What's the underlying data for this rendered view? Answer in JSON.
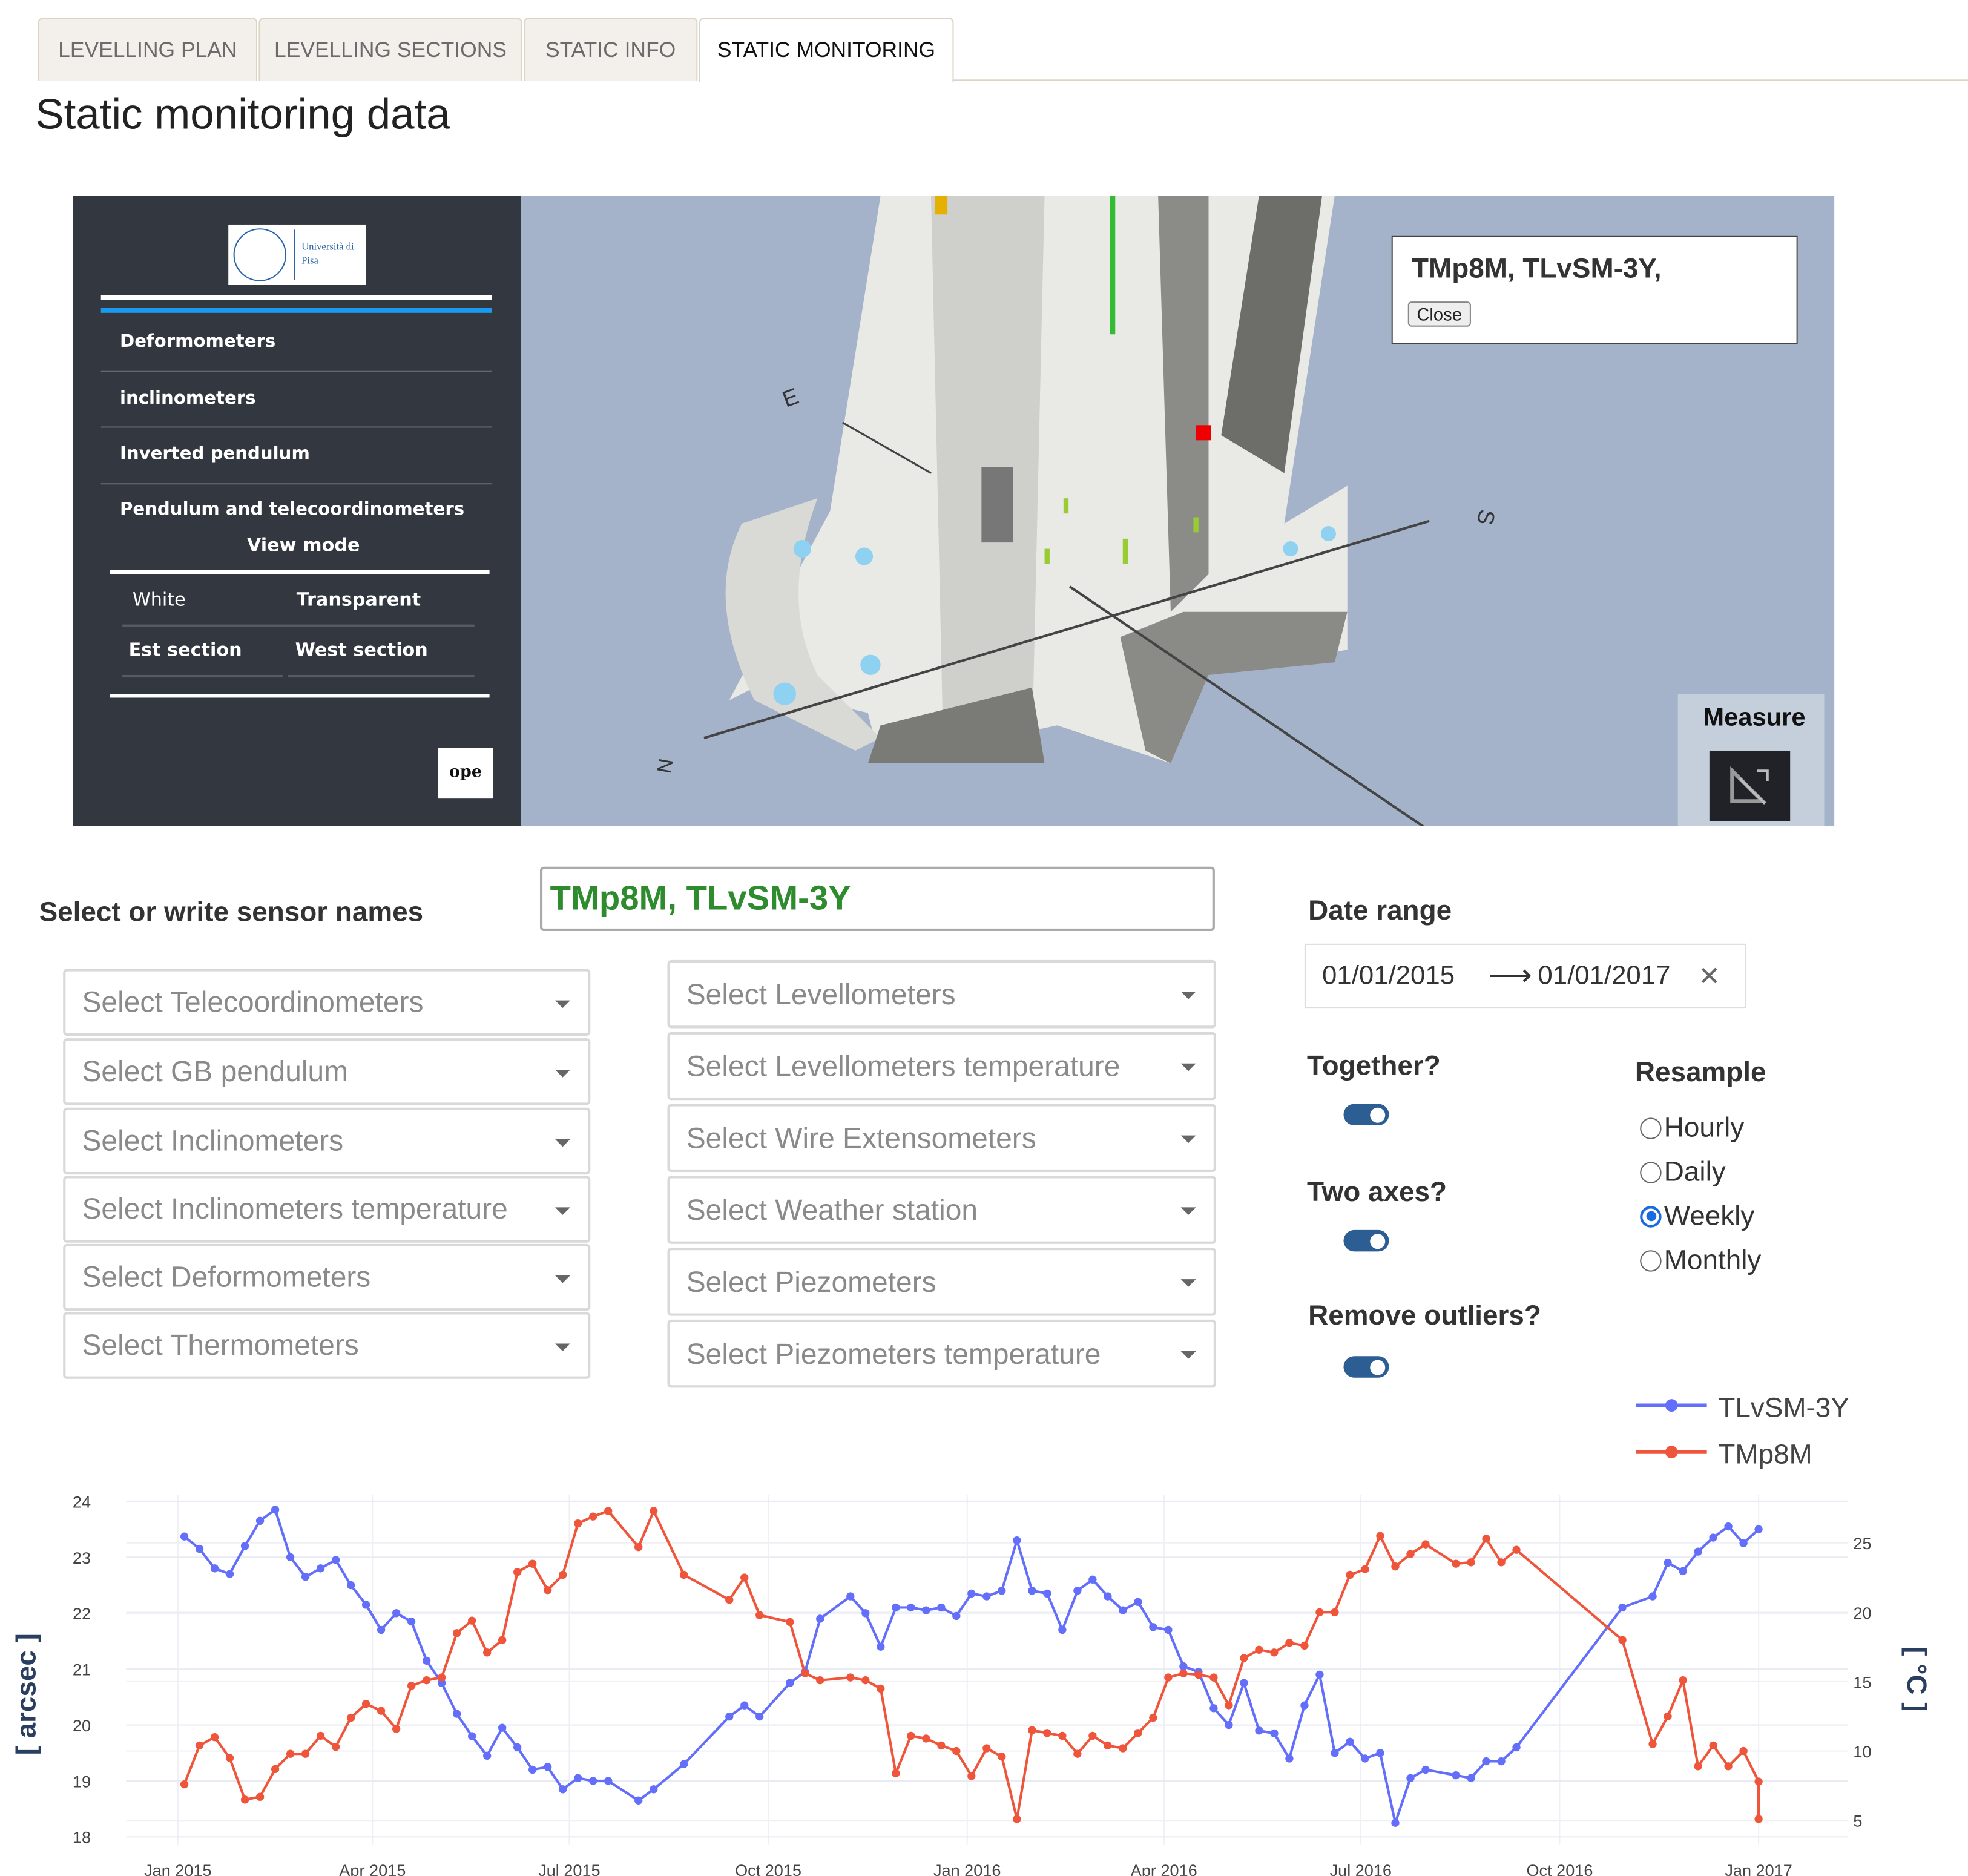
{
  "tabs": [
    {
      "label": "LEVELLING PLAN",
      "active": false
    },
    {
      "label": "LEVELLING SECTIONS",
      "active": false
    },
    {
      "label": "STATIC INFO",
      "active": false
    },
    {
      "label": "STATIC MONITORING",
      "active": true
    }
  ],
  "page_title": "Static monitoring data",
  "viewer": {
    "logo_text": "Università di Pisa",
    "menu": [
      "Deformometers",
      "inclinometers",
      "Inverted pendulum",
      "Pendulum and telecoordinometers"
    ],
    "view_mode_title": "View mode",
    "view_modes": [
      "White",
      "Transparent",
      "Est section",
      "West section"
    ],
    "ope_logo": "ope",
    "popup_text": "TMp8M, TLvSM-3Y,",
    "popup_close": "Close",
    "measure_label": "Measure",
    "compass": {
      "e": "E",
      "s": "S",
      "n": "N"
    }
  },
  "sensor_select": {
    "label": "Select or write sensor names",
    "value": "TMp8M, TLvSM-3Y",
    "left_dropdowns": [
      "Select Telecoordinometers",
      "Select GB pendulum",
      "Select Inclinometers",
      "Select Inclinometers temperature",
      "Select Deformometers",
      "Select Thermometers"
    ],
    "right_dropdowns": [
      "Select Levellometers",
      "Select Levellometers temperature",
      "Select Wire Extensometers",
      "Select Weather station",
      "Select Piezometers",
      "Select Piezometers temperature"
    ]
  },
  "date_range": {
    "label": "Date range",
    "start": "01/01/2015",
    "end": "01/01/2017"
  },
  "options": {
    "together": {
      "label": "Together?",
      "on": true
    },
    "two_axes": {
      "label": "Two axes?",
      "on": true
    },
    "remove_outliers": {
      "label": "Remove outliers?",
      "on": true
    }
  },
  "resample": {
    "label": "Resample",
    "options": [
      "Hourly",
      "Daily",
      "Weekly",
      "Monthly"
    ],
    "selected": "Weekly"
  },
  "colors": {
    "blue": "#636efa",
    "red": "#ef553b",
    "toggle": "#2d5e93"
  },
  "chart_data": {
    "type": "line",
    "title": "",
    "xlabel": "",
    "ylabel": "[ arcsec ]",
    "y2label": "[ °C ]",
    "ylim": [
      18,
      24
    ],
    "y2lim": [
      3.8,
      28
    ],
    "xlim": [
      "2014-12-20",
      "2017-01-20"
    ],
    "x_ticks": [
      {
        "date": "2015-01-01",
        "label": "Jan 2015"
      },
      {
        "date": "2015-04-01",
        "label": "Apr 2015"
      },
      {
        "date": "2015-07-01",
        "label": "Jul 2015"
      },
      {
        "date": "2015-10-01",
        "label": "Oct 2015"
      },
      {
        "date": "2016-01-01",
        "label": "Jan 2016"
      },
      {
        "date": "2016-04-01",
        "label": "Apr 2016"
      },
      {
        "date": "2016-07-01",
        "label": "Jul 2016"
      },
      {
        "date": "2016-10-01",
        "label": "Oct 2016"
      },
      {
        "date": "2017-01-01",
        "label": "Jan 2017"
      }
    ],
    "y_ticks": [
      "18",
      "19",
      "20",
      "21",
      "22",
      "23",
      "24"
    ],
    "y2_ticks": [
      "5",
      "10",
      "15",
      "20",
      "25"
    ],
    "legend_position": "top-right",
    "grid": true,
    "series": [
      {
        "name": "TLvSM-3Y",
        "axis": "y",
        "color": "#636efa",
        "points": [
          [
            "2015-01-04",
            23.37
          ],
          [
            "2015-01-11",
            23.15
          ],
          [
            "2015-01-18",
            22.8
          ],
          [
            "2015-01-25",
            22.7
          ],
          [
            "2015-02-01",
            23.2
          ],
          [
            "2015-02-08",
            23.65
          ],
          [
            "2015-02-15",
            23.85
          ],
          [
            "2015-02-22",
            23.0
          ],
          [
            "2015-03-01",
            22.65
          ],
          [
            "2015-03-08",
            22.8
          ],
          [
            "2015-03-15",
            22.95
          ],
          [
            "2015-03-22",
            22.5
          ],
          [
            "2015-03-29",
            22.15
          ],
          [
            "2015-04-05",
            21.7
          ],
          [
            "2015-04-12",
            22.0
          ],
          [
            "2015-04-19",
            21.85
          ],
          [
            "2015-04-26",
            21.15
          ],
          [
            "2015-05-03",
            20.75
          ],
          [
            "2015-05-10",
            20.2
          ],
          [
            "2015-05-17",
            19.8
          ],
          [
            "2015-05-24",
            19.45
          ],
          [
            "2015-05-31",
            19.95
          ],
          [
            "2015-06-07",
            19.6
          ],
          [
            "2015-06-14",
            19.2
          ],
          [
            "2015-06-21",
            19.25
          ],
          [
            "2015-06-28",
            18.85
          ],
          [
            "2015-07-05",
            19.05
          ],
          [
            "2015-07-12",
            19.0
          ],
          [
            "2015-07-19",
            19.0
          ],
          [
            "2015-08-02",
            18.65
          ],
          [
            "2015-08-09",
            18.85
          ],
          [
            "2015-08-23",
            19.3
          ],
          [
            "2015-09-13",
            20.15
          ],
          [
            "2015-09-20",
            20.35
          ],
          [
            "2015-09-27",
            20.15
          ],
          [
            "2015-10-11",
            20.75
          ],
          [
            "2015-10-18",
            20.95
          ],
          [
            "2015-10-25",
            21.9
          ],
          [
            "2015-11-08",
            22.3
          ],
          [
            "2015-11-15",
            22.0
          ],
          [
            "2015-11-22",
            21.4
          ],
          [
            "2015-11-29",
            22.1
          ],
          [
            "2015-12-06",
            22.1
          ],
          [
            "2015-12-13",
            22.05
          ],
          [
            "2015-12-20",
            22.1
          ],
          [
            "2015-12-27",
            21.95
          ],
          [
            "2016-01-03",
            22.35
          ],
          [
            "2016-01-10",
            22.3
          ],
          [
            "2016-01-17",
            22.4
          ],
          [
            "2016-01-24",
            23.3
          ],
          [
            "2016-01-31",
            22.4
          ],
          [
            "2016-02-07",
            22.35
          ],
          [
            "2016-02-14",
            21.7
          ],
          [
            "2016-02-21",
            22.4
          ],
          [
            "2016-02-28",
            22.6
          ],
          [
            "2016-03-06",
            22.3
          ],
          [
            "2016-03-13",
            22.05
          ],
          [
            "2016-03-20",
            22.2
          ],
          [
            "2016-03-27",
            21.75
          ],
          [
            "2016-04-03",
            21.7
          ],
          [
            "2016-04-10",
            21.05
          ],
          [
            "2016-04-17",
            20.95
          ],
          [
            "2016-04-24",
            20.3
          ],
          [
            "2016-05-01",
            20.0
          ],
          [
            "2016-05-08",
            20.75
          ],
          [
            "2016-05-15",
            19.9
          ],
          [
            "2016-05-22",
            19.85
          ],
          [
            "2016-05-29",
            19.4
          ],
          [
            "2016-06-05",
            20.35
          ],
          [
            "2016-06-12",
            20.9
          ],
          [
            "2016-06-19",
            19.5
          ],
          [
            "2016-06-26",
            19.7
          ],
          [
            "2016-07-03",
            19.4
          ],
          [
            "2016-07-10",
            19.5
          ],
          [
            "2016-07-17",
            18.25
          ],
          [
            "2016-07-24",
            19.05
          ],
          [
            "2016-07-31",
            19.2
          ],
          [
            "2016-08-14",
            19.1
          ],
          [
            "2016-08-21",
            19.05
          ],
          [
            "2016-08-28",
            19.35
          ],
          [
            "2016-09-04",
            19.35
          ],
          [
            "2016-09-11",
            19.6
          ],
          [
            "2016-10-30",
            22.1
          ],
          [
            "2016-11-13",
            22.3
          ],
          [
            "2016-11-20",
            22.9
          ],
          [
            "2016-11-27",
            22.75
          ],
          [
            "2016-12-04",
            23.1
          ],
          [
            "2016-12-11",
            23.35
          ],
          [
            "2016-12-18",
            23.55
          ],
          [
            "2016-12-25",
            23.25
          ],
          [
            "2017-01-01",
            23.5
          ]
        ]
      },
      {
        "name": "TMp8M",
        "axis": "y2",
        "color": "#ef553b",
        "points": [
          [
            "2015-01-04",
            7.6
          ],
          [
            "2015-01-11",
            10.4
          ],
          [
            "2015-01-18",
            11.0
          ],
          [
            "2015-01-25",
            9.5
          ],
          [
            "2015-02-01",
            6.5
          ],
          [
            "2015-02-08",
            6.7
          ],
          [
            "2015-02-15",
            8.7
          ],
          [
            "2015-02-22",
            9.8
          ],
          [
            "2015-03-01",
            9.8
          ],
          [
            "2015-03-08",
            11.1
          ],
          [
            "2015-03-15",
            10.3
          ],
          [
            "2015-03-22",
            12.4
          ],
          [
            "2015-03-29",
            13.4
          ],
          [
            "2015-04-05",
            12.9
          ],
          [
            "2015-04-12",
            11.6
          ],
          [
            "2015-04-19",
            14.7
          ],
          [
            "2015-04-26",
            15.1
          ],
          [
            "2015-05-03",
            15.3
          ],
          [
            "2015-05-10",
            18.5
          ],
          [
            "2015-05-17",
            19.4
          ],
          [
            "2015-05-24",
            17.1
          ],
          [
            "2015-05-31",
            18.0
          ],
          [
            "2015-06-07",
            22.9
          ],
          [
            "2015-06-14",
            23.5
          ],
          [
            "2015-06-21",
            21.6
          ],
          [
            "2015-06-28",
            22.7
          ],
          [
            "2015-07-05",
            26.4
          ],
          [
            "2015-07-12",
            26.9
          ],
          [
            "2015-07-19",
            27.3
          ],
          [
            "2015-08-02",
            24.7
          ],
          [
            "2015-08-09",
            27.3
          ],
          [
            "2015-08-23",
            22.7
          ],
          [
            "2015-09-13",
            20.9
          ],
          [
            "2015-09-20",
            22.5
          ],
          [
            "2015-09-27",
            19.8
          ],
          [
            "2015-10-11",
            19.3
          ],
          [
            "2015-10-18",
            15.6
          ],
          [
            "2015-10-25",
            15.1
          ],
          [
            "2015-11-08",
            15.3
          ],
          [
            "2015-11-15",
            15.1
          ],
          [
            "2015-11-22",
            14.5
          ],
          [
            "2015-11-29",
            8.4
          ],
          [
            "2015-12-06",
            11.1
          ],
          [
            "2015-12-13",
            10.9
          ],
          [
            "2015-12-20",
            10.4
          ],
          [
            "2015-12-27",
            10.0
          ],
          [
            "2016-01-03",
            8.2
          ],
          [
            "2016-01-10",
            10.2
          ],
          [
            "2016-01-17",
            9.6
          ],
          [
            "2016-01-24",
            5.1
          ],
          [
            "2016-01-31",
            11.5
          ],
          [
            "2016-02-07",
            11.3
          ],
          [
            "2016-02-14",
            11.1
          ],
          [
            "2016-02-21",
            9.8
          ],
          [
            "2016-02-28",
            11.1
          ],
          [
            "2016-03-06",
            10.4
          ],
          [
            "2016-03-13",
            10.2
          ],
          [
            "2016-03-20",
            11.3
          ],
          [
            "2016-03-27",
            12.4
          ],
          [
            "2016-04-03",
            15.3
          ],
          [
            "2016-04-10",
            15.6
          ],
          [
            "2016-04-17",
            15.5
          ],
          [
            "2016-04-24",
            15.3
          ],
          [
            "2016-05-01",
            13.3
          ],
          [
            "2016-05-08",
            16.7
          ],
          [
            "2016-05-15",
            17.3
          ],
          [
            "2016-05-22",
            17.1
          ],
          [
            "2016-05-29",
            17.8
          ],
          [
            "2016-06-05",
            17.6
          ],
          [
            "2016-06-12",
            20.0
          ],
          [
            "2016-06-19",
            20.0
          ],
          [
            "2016-06-26",
            22.7
          ],
          [
            "2016-07-03",
            23.1
          ],
          [
            "2016-07-10",
            25.5
          ],
          [
            "2016-07-17",
            23.3
          ],
          [
            "2016-07-24",
            24.2
          ],
          [
            "2016-07-31",
            24.9
          ],
          [
            "2016-08-14",
            23.5
          ],
          [
            "2016-08-21",
            23.6
          ],
          [
            "2016-08-28",
            25.3
          ],
          [
            "2016-09-04",
            23.6
          ],
          [
            "2016-09-11",
            24.5
          ],
          [
            "2016-10-30",
            18.0
          ],
          [
            "2016-11-13",
            10.5
          ],
          [
            "2016-11-20",
            12.5
          ],
          [
            "2016-11-27",
            15.1
          ],
          [
            "2016-12-04",
            8.9
          ],
          [
            "2016-12-11",
            10.4
          ],
          [
            "2016-12-18",
            8.9
          ],
          [
            "2016-12-25",
            10.0
          ],
          [
            "2017-01-01",
            7.8
          ],
          [
            "2017-01-01",
            5.1
          ]
        ]
      }
    ]
  }
}
